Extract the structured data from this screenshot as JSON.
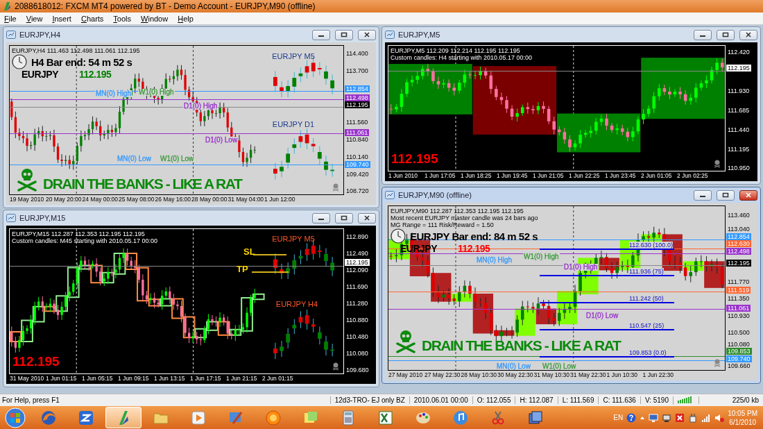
{
  "window": {
    "title": "2088618012: FXCM MT4 powered by BT - Demo Account - EURJPY,M90 (offline)"
  },
  "menu": [
    "File",
    "View",
    "Insert",
    "Charts",
    "Tools",
    "Window",
    "Help"
  ],
  "charts": [
    {
      "title": "EURJPY,H4",
      "active": false,
      "kind": "light-plain",
      "info": [
        "EURJPY,H4  111.463 112.498 111.061 112.195"
      ],
      "bar_end": "H4 Bar end: 54 m 52 s",
      "symbol": "EURJPY",
      "symbol_price": {
        "text": "112.195",
        "color": "#008000"
      },
      "side_labels": [
        {
          "text": "EURJPY M5",
          "color": "#1c3a8a"
        },
        {
          "text": "EURJPY D1",
          "color": "#1c3a8a"
        }
      ],
      "levels": [
        {
          "text": "112.854",
          "color": "#3399ff"
        },
        {
          "text": "112.498",
          "color": "#9933cc"
        },
        {
          "text": "112.195",
          "color": "#000000"
        },
        {
          "text": "111.061",
          "color": "#9933cc"
        },
        {
          "text": "109.740",
          "color": "#3399ff"
        }
      ],
      "level_labels": [
        {
          "text": "MN(0) High",
          "color": "#3399ff"
        },
        {
          "text": "W1(0) High",
          "color": "#3c9a3c"
        },
        {
          "text": "D1(0) High",
          "color": "#9933cc"
        },
        {
          "text": "D1(0) Low",
          "color": "#9933cc"
        },
        {
          "text": "MN(0) Low",
          "color": "#3399ff"
        },
        {
          "text": "W1(0) Low",
          "color": "#3c9a3c"
        }
      ],
      "ticks": [
        "114.400",
        "113.700",
        "111.560",
        "110.840",
        "110.140",
        "109.420",
        "108.720"
      ],
      "times": [
        "19 May 2010",
        "20 May 20:00",
        "24 May 00:00",
        "25 May 08:00",
        "26 May 16:00",
        "28 May 00:00",
        "31 May 04:00",
        "1 Jun 12:00"
      ],
      "slogan": "DRAIN THE BANKS - LIKE A RAT"
    },
    {
      "title": "EURJPY,M15",
      "active": false,
      "kind": "dark-hollow",
      "info": [
        "EURJPY,M15  112.287 112.353 112.195 112.195",
        "Custom candles: M45 starting with 2010.05.17 00:00"
      ],
      "side_labels": [
        {
          "text": "EURJPY M5",
          "color": "#ff5a2a"
        },
        {
          "text": "EURJPY H4",
          "color": "#ff5a2a"
        }
      ],
      "trade_lines": [
        {
          "text": "SL"
        },
        {
          "text": "TP"
        }
      ],
      "levels": [
        {
          "text": "112.195",
          "color": "#ffffff"
        }
      ],
      "ticks": [
        "112.890",
        "112.490",
        "112.090",
        "111.690",
        "111.280",
        "110.880",
        "110.480",
        "110.080",
        "109.680"
      ],
      "times": [
        "31 May 2010",
        "1 Jun 01:15",
        "1 Jun 05:15",
        "1 Jun 09:15",
        "1 Jun 13:15",
        "1 Jun 17:15",
        "1 Jun 21:15",
        "2 Jun 01:15"
      ],
      "big_price": "112.195"
    },
    {
      "title": "EURJPY,M5",
      "active": false,
      "kind": "dark-boxes",
      "info": [
        "EURJPY,M5  112.209 112.214 112.195 112.195",
        "Custom candles: H4 starting with 2010.05.17 00:00"
      ],
      "levels": [
        {
          "text": "112.195",
          "color": "#ffffff"
        }
      ],
      "ticks": [
        "112.420",
        "111.930",
        "111.685",
        "111.440",
        "111.195",
        "110.950"
      ],
      "times": [
        "1 Jun 2010",
        "1 Jun 17:05",
        "1 Jun 18:25",
        "1 Jun 19:45",
        "1 Jun 21:05",
        "1 Jun 22:25",
        "1 Jun 23:45",
        "2 Jun 01:05",
        "2 Jun 02:25"
      ],
      "big_price": "112.195"
    },
    {
      "title": "EURJPY,M90 (offline)",
      "active": true,
      "kind": "light-blocks",
      "info": [
        "EURJPY,M90  112.287 112.353 112.195 112.195",
        "Most recent EURJPY master candle was 24 bars ago",
        "MG Range = 111  Risk/Reward = 1.50"
      ],
      "bar_end": "EURJPY Bar end: 84 m 52 s",
      "symbol": "EURJPY",
      "symbol_price": {
        "text": "112.195",
        "color": "#ff0000"
      },
      "levels": [
        {
          "text": "112.854",
          "color": "#3399ff"
        },
        {
          "text": "112.630",
          "color": "#ff6633"
        },
        {
          "text": "112.498",
          "color": "#9933cc"
        },
        {
          "text": "112.195",
          "color": "#000000"
        },
        {
          "text": "111.519",
          "color": "#ff6633"
        },
        {
          "text": "111.061",
          "color": "#9933cc"
        },
        {
          "text": "109.853",
          "color": "#2e8b2e"
        },
        {
          "text": "109.740",
          "color": "#3399ff"
        }
      ],
      "level_labels": [
        {
          "text": "MN(0) High",
          "color": "#3399ff"
        },
        {
          "text": "W1(0) High",
          "color": "#3c9a3c"
        },
        {
          "text": "D1(0) High",
          "color": "#9933cc"
        },
        {
          "text": "D1(0) Low",
          "color": "#9933cc"
        },
        {
          "text": "MN(0) Low",
          "color": "#3399ff"
        },
        {
          "text": "W1(0) Low",
          "color": "#3c9a3c"
        }
      ],
      "fib_levels": [
        "112.630 (100.0)",
        "111.936 (75)",
        "111.242 (50)",
        "110.547 (25)",
        "109.853 (0.0)"
      ],
      "ticks": [
        "113.460",
        "113.040",
        "111.770",
        "111.350",
        "110.930",
        "110.500",
        "110.080",
        "109.660"
      ],
      "times": [
        "27 May 2010",
        "27 May 22:30",
        "28 May 10:30",
        "30 May 22:30",
        "31 May 10:30",
        "31 May 22:30",
        "1 Jun 10:30",
        "1 Jun 22:30"
      ],
      "slogan": "DRAIN THE BANKS - LIKE A RAT"
    }
  ],
  "status_bar": {
    "help": "For Help, press F1",
    "cells": [
      "12d3-TRO- EJ only BZ",
      "2010.06.01 00:00",
      "O: 112.055",
      "H: 112.087",
      "L: 111.569",
      "C: 111.636",
      "V: 5190"
    ],
    "traffic": "225/0 kb"
  },
  "taskbar": {
    "apps": [
      {
        "kind": "browser",
        "selected": false
      },
      {
        "kind": "sync",
        "selected": false
      },
      {
        "kind": "trader",
        "selected": true
      },
      {
        "kind": "folder",
        "selected": false
      },
      {
        "kind": "media",
        "selected": false
      },
      {
        "kind": "brush",
        "selected": false
      },
      {
        "kind": "ball",
        "selected": false
      },
      {
        "kind": "notes",
        "selected": false
      },
      {
        "kind": "calculator",
        "selected": false
      },
      {
        "kind": "spreadsheet",
        "selected": false
      },
      {
        "kind": "palette",
        "selected": false
      },
      {
        "kind": "music",
        "selected": false
      },
      {
        "kind": "scissors",
        "selected": false
      },
      {
        "kind": "windows",
        "selected": false
      }
    ],
    "language": "EN",
    "time": "10:05 PM",
    "date": "6/1/2010"
  }
}
